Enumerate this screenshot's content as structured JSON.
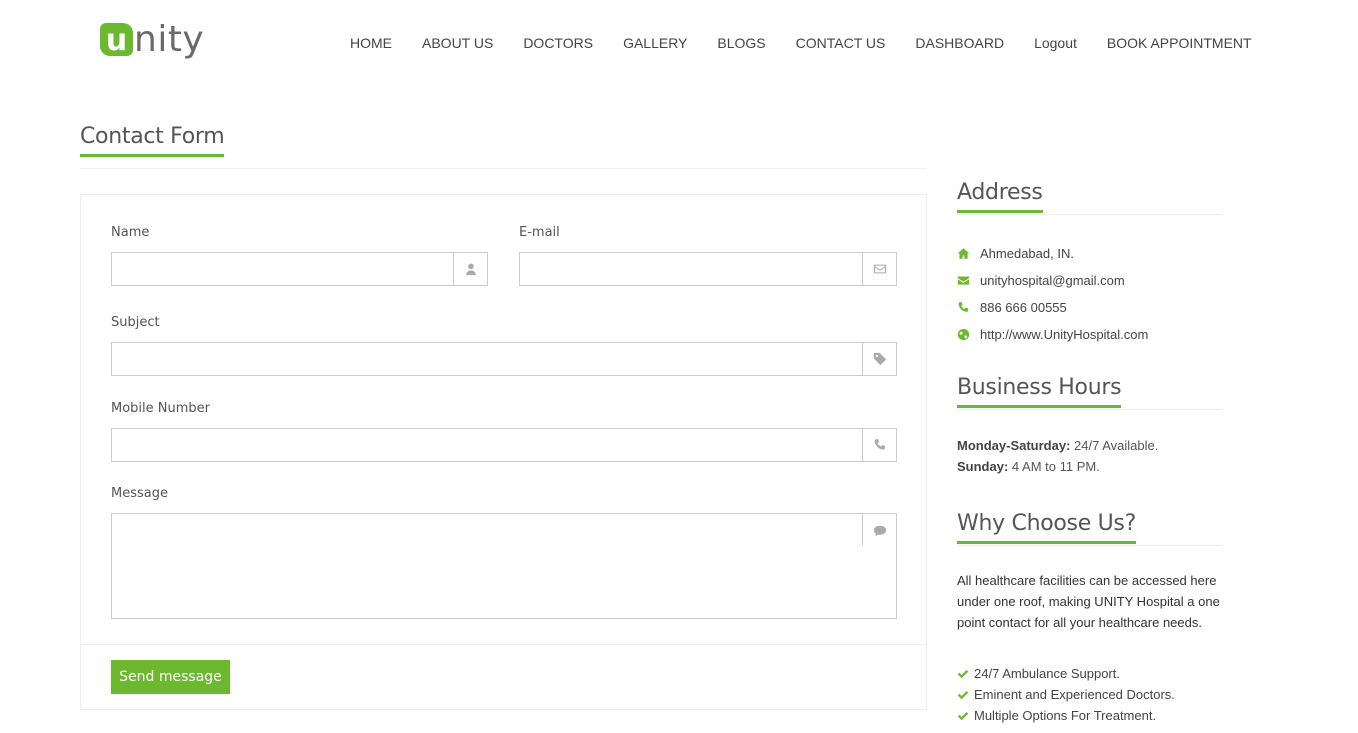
{
  "brand": {
    "logo_letter": "u",
    "logo_rest": "nity",
    "accent_color": "#6cb92f"
  },
  "nav": [
    {
      "label": "HOME"
    },
    {
      "label": "ABOUT US"
    },
    {
      "label": "DOCTORS"
    },
    {
      "label": "GALLERY"
    },
    {
      "label": "BLOGS"
    },
    {
      "label": "CONTACT US"
    },
    {
      "label": "DASHBOARD"
    },
    {
      "label": "Logout"
    },
    {
      "label": "BOOK APPOINTMENT"
    }
  ],
  "contact_form": {
    "title": "Contact Form",
    "name": {
      "label": "Name",
      "value": "",
      "icon": "user-icon"
    },
    "email": {
      "label": "E-mail",
      "value": "",
      "icon": "envelope-icon"
    },
    "subject": {
      "label": "Subject",
      "value": "",
      "icon": "tag-icon"
    },
    "mobile": {
      "label": "Mobile Number",
      "value": "",
      "icon": "phone-icon"
    },
    "message": {
      "label": "Message",
      "value": "",
      "icon": "comment-icon"
    },
    "submit_label": "Send message"
  },
  "address": {
    "title": "Address",
    "items": [
      {
        "icon": "home-icon",
        "text": "Ahmedabad, IN."
      },
      {
        "icon": "envelope-icon",
        "text": "unityhospital@gmail.com"
      },
      {
        "icon": "phone-icon",
        "text": "886 666 00555"
      },
      {
        "icon": "globe-icon",
        "text": "http://www.UnityHospital.com"
      }
    ]
  },
  "business_hours": {
    "title": "Business Hours",
    "rows": [
      {
        "day": "Monday-Saturday:",
        "time": "24/7 Available."
      },
      {
        "day": "Sunday:",
        "time": "4 AM to 11 PM."
      }
    ]
  },
  "why_choose": {
    "title": "Why Choose Us?",
    "text": "All healthcare facilities can be accessed here under one roof, making UNITY Hospital a one point contact for all your healthcare needs.",
    "items": [
      {
        "text": "24/7 Ambulance Support."
      },
      {
        "text": "Eminent and Experienced Doctors."
      },
      {
        "text": "Multiple Options For Treatment."
      }
    ]
  }
}
